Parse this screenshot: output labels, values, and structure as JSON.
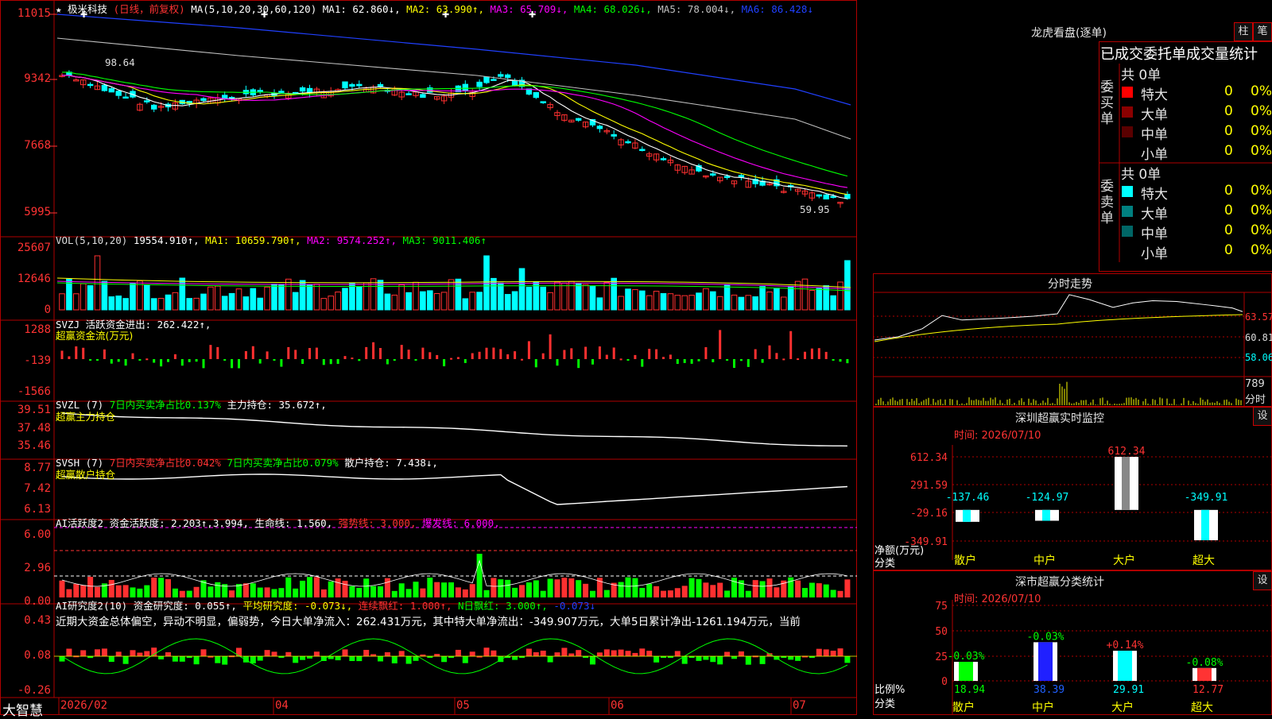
{
  "stock": {
    "name": "★ 极米科技",
    "period_tag": "(日线，前复权)"
  },
  "kline": {
    "ma_header": "MA(5,10,20,30,60,120)",
    "ma1": "MA1: 62.860↓,",
    "ma2": "MA2: 63.990↑,",
    "ma3": "MA3: 65.709↓,",
    "ma4": "MA4: 68.026↓,",
    "ma5": "MA5: 78.004↓,",
    "ma6": "MA6: 86.428↓",
    "y_labels": [
      "11015",
      "9342",
      "7668",
      "5995"
    ],
    "high_mark": "98.64",
    "low_mark": "59.95"
  },
  "vol": {
    "header": "VOL(5,10,20)",
    "value": "19554.910↑,",
    "ma1": "MA1: 10659.790↑,",
    "ma2": "MA2: 9574.252↑,",
    "ma3": "MA3: 9011.406↑",
    "y_labels": [
      "25607",
      "12646",
      "0"
    ]
  },
  "svzj": {
    "header": "SVZJ  活跃资金进出: 262.422↑,",
    "sub": "超赢资金流(万元)",
    "y_labels": [
      "1288",
      "-139",
      "-1566"
    ]
  },
  "svzl": {
    "header": "SVZL (7)",
    "mid": "7日内买卖净占比0.137%",
    "tail": "主力持仓: 35.672↑,",
    "sub": "超赢主力持仓",
    "y_labels": [
      "39.51",
      "37.48",
      "35.46"
    ]
  },
  "svsh": {
    "header": "SVSH (7)",
    "mid1": "7日内买卖净占比0.042%",
    "mid2": "7日内买卖净占比0.079%",
    "tail": "散户持仓: 7.438↓,",
    "sub": "超赢散户持仓",
    "y_labels": [
      "8.77",
      "7.42",
      "6.13"
    ]
  },
  "ai_active": {
    "header": "AI活跃度2  资金活跃度: 2.203↑,3.994,",
    "life": "生命线: 1.560,",
    "strong": "强势线: 3.000,",
    "burst": "爆发线: 6.000,",
    "y_labels": [
      "6.00",
      "2.96",
      "0.00"
    ]
  },
  "ai_research": {
    "header": "AI研究度2(10)  资金研究度: 0.055↑,",
    "avg": "平均研究度: -0.073↓,",
    "cont": "连续飘红: 1.000↑,",
    "nday": "N日飘红: 3.000↑,",
    "last": "-0.073↓",
    "text": "近期大资金总体偏空，异动不明显，偏弱势，今日大单净流入：262.431万元，其中特大单净流出：-349.907万元，大单5日累计净出-1261.194万元，当前",
    "y_labels": [
      "0.43",
      "0.08",
      "-0.26"
    ]
  },
  "bottom_bar": {
    "brand": "大智慧",
    "dates": [
      "2026/02",
      "04",
      "05",
      "06",
      "07"
    ]
  },
  "lhb": {
    "title": "龙虎看盘(逐单)",
    "btn1": "柱",
    "btn2": "笔",
    "heading": "已成交委托单成交量统计",
    "buy": {
      "label": "委买单",
      "total": "共 0单",
      "rows": [
        {
          "name": "特大",
          "n": "0",
          "p": "0%",
          "color": "#ff0000"
        },
        {
          "name": "大单",
          "n": "0",
          "p": "0%",
          "color": "#8b0000"
        },
        {
          "name": "中单",
          "n": "0",
          "p": "0%",
          "color": "#5a0000"
        },
        {
          "name": "小单",
          "n": "0",
          "p": "0%",
          "color": "#000000"
        }
      ]
    },
    "sell": {
      "label": "委卖单",
      "total": "共 0单",
      "rows": [
        {
          "name": "特大",
          "n": "0",
          "p": "0%",
          "color": "#00ffff"
        },
        {
          "name": "大单",
          "n": "0",
          "p": "0%",
          "color": "#008080"
        },
        {
          "name": "中单",
          "n": "0",
          "p": "0%",
          "color": "#006666"
        },
        {
          "name": "小单",
          "n": "0",
          "p": "0%",
          "color": "#000000"
        }
      ]
    }
  },
  "intraday": {
    "title": "分时走势",
    "y_labels": [
      "63.57",
      "60.81",
      "58.06"
    ],
    "vol_label": "789",
    "vol_unit": "分时"
  },
  "sz_monitor": {
    "title": "深圳超赢实时监控",
    "gear": "设",
    "time": "时间: 2026/07/10",
    "y_labels": [
      "612.34",
      "291.59",
      "-29.16",
      "-349.91"
    ],
    "unit1": "净额(万元)",
    "unit2": "分类",
    "bars": [
      {
        "cat": "散户",
        "value": -137.46,
        "label": "-137.46"
      },
      {
        "cat": "中户",
        "value": -124.97,
        "label": "-124.97"
      },
      {
        "cat": "大户",
        "value": 612.34,
        "label": "612.34"
      },
      {
        "cat": "超大",
        "value": -349.91,
        "label": "-349.91"
      }
    ]
  },
  "sz_class": {
    "title": "深市超赢分类统计",
    "gear": "设",
    "time": "时间: 2026/07/10",
    "y_labels": [
      "75",
      "50",
      "25",
      "0"
    ],
    "unit1": "比例%",
    "unit2": "分类",
    "bars": [
      {
        "cat": "散户",
        "value": 18.94,
        "label": "18.94",
        "delta": "-0.03%"
      },
      {
        "cat": "中户",
        "value": 38.39,
        "label": "38.39",
        "delta": "-0.03%"
      },
      {
        "cat": "大户",
        "value": 29.91,
        "label": "29.91",
        "delta": "+0.14%"
      },
      {
        "cat": "超大",
        "value": 12.77,
        "label": "12.77",
        "delta": "-0.08%"
      }
    ]
  },
  "colors": {
    "up": "#ff3030",
    "down": "#00ffff",
    "ma1": "#ffffff",
    "ma2": "#ffff00",
    "ma3": "#ff00ff",
    "ma4": "#00ff00",
    "ma5": "#c0c0c0",
    "ma6": "#2040ff",
    "grid": "#b00000"
  }
}
